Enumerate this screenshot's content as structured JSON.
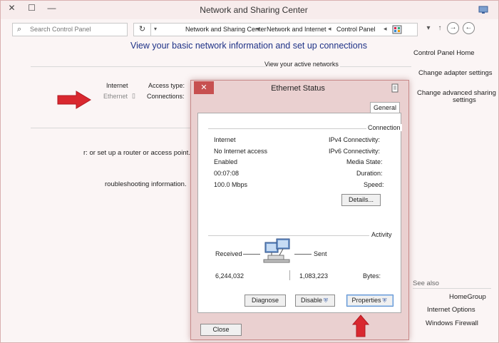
{
  "window": {
    "title": "Network and Sharing Center",
    "controls": {
      "close": "✕",
      "maximize": "☐",
      "minimize": "—"
    }
  },
  "addressbar": {
    "search_placeholder": "Search Control Panel",
    "refresh_glyph": "↻",
    "dropdown_glyph": "▾",
    "crumbs": [
      "Control Panel",
      "Network and Internet",
      "Network and Sharing Center"
    ],
    "crumb_sep": "◂",
    "back_glyph": "←",
    "forward_glyph": "→",
    "up_glyph": "↑",
    "history_glyph": "▾"
  },
  "main": {
    "heading": "View your basic network information and set up connections",
    "active_networks_label": "View your active networks",
    "access_type_label": "Access type:",
    "access_type_value": "Internet",
    "connections_label": "Connections:",
    "connections_value": "Ethernet",
    "partial_router_text": "r: or set up a router or access point.",
    "partial_troubleshoot_text": "roubleshooting information."
  },
  "left_nav": {
    "home": "Control Panel Home",
    "adapter": "Change adapter settings",
    "advanced_line1": "Change advanced sharing",
    "advanced_line2": "settings",
    "see_also": "See also",
    "homegroup": "HomeGroup",
    "internet_options": "Internet Options",
    "firewall": "Windows Firewall"
  },
  "dialog": {
    "title": "Ethernet Status",
    "close_glyph": "✕",
    "tab": "General",
    "connection_group": "Connection",
    "rows": [
      {
        "label": "IPv4 Connectivity:",
        "value": "Internet"
      },
      {
        "label": "IPv6 Connectivity:",
        "value": "No Internet access"
      },
      {
        "label": "Media State:",
        "value": "Enabled"
      },
      {
        "label": "Duration:",
        "value": "00:07:08"
      },
      {
        "label": "Speed:",
        "value": "100.0 Mbps"
      }
    ],
    "details_button": "Details...",
    "activity_group": "Activity",
    "sent_label": "Sent",
    "received_label": "Received",
    "bytes_label": "Bytes:",
    "bytes_sent": "1,083,223",
    "bytes_received": "6,244,032",
    "properties_button": "Properties",
    "disable_button": "Disable",
    "diagnose_button": "Diagnose",
    "close_button": "Close"
  },
  "colors": {
    "accent_red": "#d9282f",
    "heading_blue": "#1e3287",
    "dialog_frame": "#ead0d0",
    "close_button": "#c75050"
  }
}
